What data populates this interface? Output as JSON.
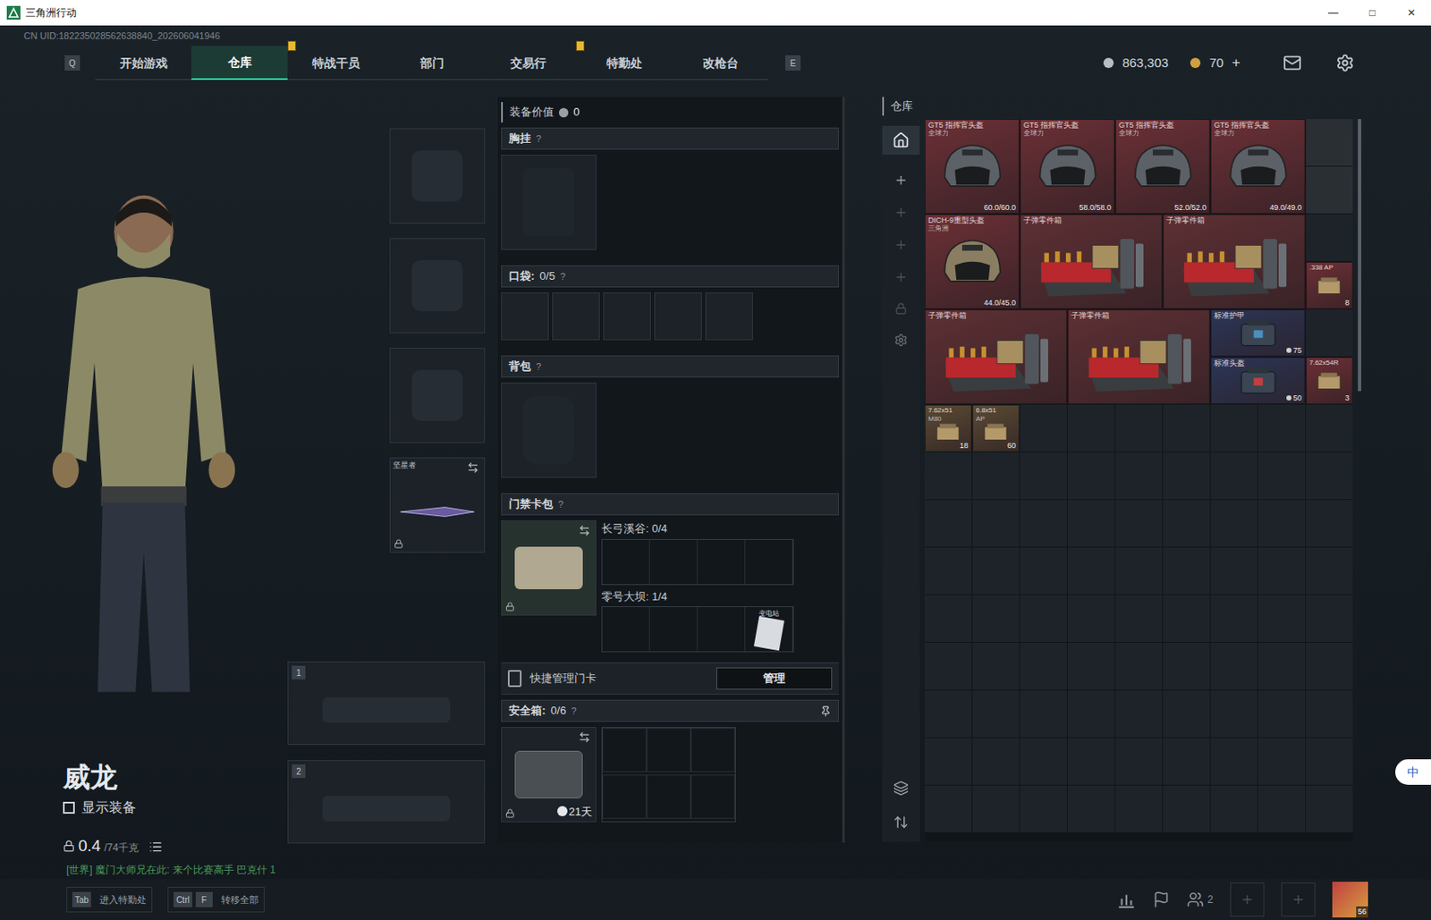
{
  "window": {
    "title": "三角洲行动",
    "controls": [
      "—",
      "□",
      "✕"
    ]
  },
  "uid": "CN UID:182235028562638840_202606041946",
  "nav": {
    "left_key": "Q",
    "right_key": "E",
    "tabs": [
      {
        "label": "开始游戏",
        "selected": false,
        "alert": false
      },
      {
        "label": "仓库",
        "selected": true,
        "alert": false
      },
      {
        "label": "特战干员",
        "selected": false,
        "alert": true
      },
      {
        "label": "部门",
        "selected": false,
        "alert": false
      },
      {
        "label": "交易行",
        "selected": false,
        "alert": false
      },
      {
        "label": "特勤处",
        "selected": false,
        "alert": true
      },
      {
        "label": "改枪台",
        "selected": false,
        "alert": false
      }
    ]
  },
  "currency": {
    "coins": "863,303",
    "tokens": "70",
    "add": "+"
  },
  "character": {
    "name": "威龙",
    "show_equipment": {
      "label": "显示装备",
      "checked": false
    },
    "weight": "0.4",
    "capacity": "/74千克"
  },
  "chat": "[世界] 魔门大师兄在此: 来个比赛高手 巴克什 1",
  "slots": [
    {
      "kind": "helmet",
      "label": "",
      "filled": false
    },
    {
      "kind": "armor",
      "label": "",
      "filled": false
    },
    {
      "kind": "pistol",
      "label": "",
      "filled": false
    },
    {
      "kind": "melee",
      "label": "坚星者",
      "filled": true
    }
  ],
  "weapons": [
    {
      "number": "1"
    },
    {
      "number": "2"
    }
  ],
  "loadout": {
    "value_label": "装备价值",
    "value": "0",
    "chest": {
      "label": "胸挂",
      "help": "?"
    },
    "pockets": {
      "label": "口袋:",
      "count": "0/5",
      "help": "?",
      "slots": 5
    },
    "backpack": {
      "label": "背包",
      "help": "?"
    },
    "keycards": {
      "label": "门禁卡包",
      "help": "?",
      "maps": [
        {
          "name": "长弓溪谷: 0/4",
          "cards": [
            false,
            false,
            false,
            false
          ],
          "card_label": ""
        },
        {
          "name": "零号大坝: 1/4",
          "cards": [
            false,
            false,
            false,
            true
          ],
          "card_label": "变电站"
        }
      ]
    },
    "quick": {
      "label": "快捷管理门卡",
      "button": "管理"
    },
    "safe": {
      "label": "安全箱:",
      "count": "0/6",
      "help": "?",
      "timer": "21天",
      "cells": 6
    }
  },
  "warehouse": {
    "title": "仓库",
    "items": [
      {
        "kind": "helmet",
        "name": "GT5 指挥官头盔",
        "sub": "全球力",
        "value": "60.0/60.0",
        "color": "#6b3036",
        "cell": [
          0,
          0
        ],
        "span": [
          2,
          2
        ]
      },
      {
        "kind": "helmet",
        "name": "GT5 指挥官头盔",
        "sub": "全球力",
        "value": "58.0/58.0",
        "color": "#6b3036",
        "cell": [
          2,
          0
        ],
        "span": [
          2,
          2
        ]
      },
      {
        "kind": "helmet",
        "name": "GT5 指挥官头盔",
        "sub": "全球力",
        "value": "52.0/52.0",
        "color": "#6b3036",
        "cell": [
          4,
          0
        ],
        "span": [
          2,
          2
        ]
      },
      {
        "kind": "helmet",
        "name": "GT5 指挥官头盔",
        "sub": "全球力",
        "value": "49.0/49.0",
        "color": "#6b3036",
        "cell": [
          6,
          0
        ],
        "span": [
          2,
          2
        ]
      },
      {
        "kind": "helmet2",
        "name": "DICH-9重型头盔",
        "sub": "三角洲",
        "value": "44.0/45.0",
        "color": "#6b3036",
        "cell": [
          0,
          2
        ],
        "span": [
          2,
          2
        ]
      },
      {
        "kind": "crate",
        "name": "子弹零件箱",
        "sub": "",
        "value": "",
        "color": "#5e3034",
        "cell": [
          2,
          2
        ],
        "span": [
          3,
          2
        ]
      },
      {
        "kind": "crate",
        "name": "子弹零件箱",
        "sub": "",
        "value": "",
        "color": "#5e3034",
        "cell": [
          5,
          2
        ],
        "span": [
          3,
          2
        ]
      },
      {
        "kind": "ammo",
        "name": ".338 AP",
        "sub": "",
        "value": "8",
        "color": "#6b3036",
        "cell": [
          8,
          3
        ],
        "span": [
          1,
          1
        ]
      },
      {
        "kind": "crate",
        "name": "子弹零件箱",
        "sub": "",
        "value": "",
        "color": "#5e3034",
        "cell": [
          0,
          4
        ],
        "span": [
          3,
          2
        ]
      },
      {
        "kind": "crate",
        "name": "子弹零件箱",
        "sub": "",
        "value": "",
        "color": "#5e3034",
        "cell": [
          3,
          4
        ],
        "span": [
          3,
          2
        ]
      },
      {
        "kind": "armor",
        "name": "标准护甲",
        "sub": "",
        "value": "75",
        "color": "#2c3556",
        "cell": [
          6,
          4
        ],
        "span": [
          2,
          1
        ]
      },
      {
        "kind": "bag",
        "name": "标准头盔",
        "sub": "",
        "value": "50",
        "color": "#2c3556",
        "cell": [
          6,
          5
        ],
        "span": [
          2,
          1
        ]
      },
      {
        "kind": "ammo",
        "name": "7.62x54R",
        "sub": "",
        "value": "3",
        "color": "#6b3036",
        "cell": [
          8,
          5
        ],
        "span": [
          1,
          1
        ]
      },
      {
        "kind": "ammo",
        "name": "7.62x51",
        "sub": "M80",
        "value": "18",
        "color": "#5a4a34",
        "cell": [
          0,
          6
        ],
        "span": [
          1,
          1
        ]
      },
      {
        "kind": "ammo",
        "name": "6.8x51",
        "sub": "AP",
        "value": "60",
        "color": "#5a4a34",
        "cell": [
          1,
          6
        ],
        "span": [
          1,
          1
        ]
      }
    ]
  },
  "bottom": {
    "hints": [
      {
        "keys": [
          "Tab"
        ],
        "label": "进入特勤处"
      },
      {
        "keys": [
          "Ctrl",
          "F"
        ],
        "label": "转移全部"
      }
    ],
    "friends": "2",
    "level": "56"
  },
  "ime": "中"
}
